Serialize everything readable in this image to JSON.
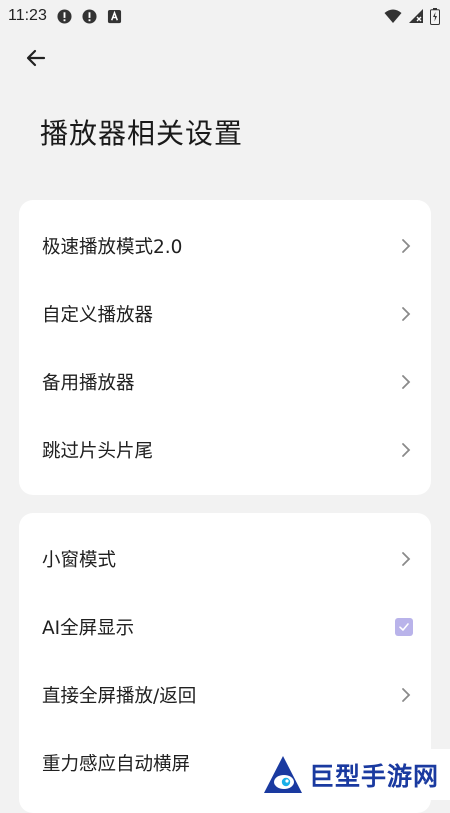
{
  "status_bar": {
    "time": "11:23",
    "icons": [
      "alert-icon",
      "alert-icon",
      "keyboard-a-icon",
      "wifi-icon",
      "signal-icon",
      "battery-icon"
    ]
  },
  "header": {
    "back_icon": "arrow-left-icon",
    "title": "播放器相关设置"
  },
  "groups": [
    {
      "items": [
        {
          "label": "极速播放模式2.0",
          "control": "chevron"
        },
        {
          "label": "自定义播放器",
          "control": "chevron"
        },
        {
          "label": "备用播放器",
          "control": "chevron"
        },
        {
          "label": "跳过片头片尾",
          "control": "chevron"
        }
      ]
    },
    {
      "items": [
        {
          "label": "小窗模式",
          "control": "chevron"
        },
        {
          "label": "AI全屏显示",
          "control": "checkbox",
          "checked": true
        },
        {
          "label": "直接全屏播放/返回",
          "control": "chevron"
        },
        {
          "label": "重力感应自动横屏",
          "control": "none"
        }
      ]
    }
  ],
  "watermark": {
    "text": "巨型手游网"
  },
  "colors": {
    "background": "#f2f2f2",
    "card": "#ffffff",
    "checkbox": "#b9b3ea",
    "watermark_text": "#1a3aa0"
  }
}
